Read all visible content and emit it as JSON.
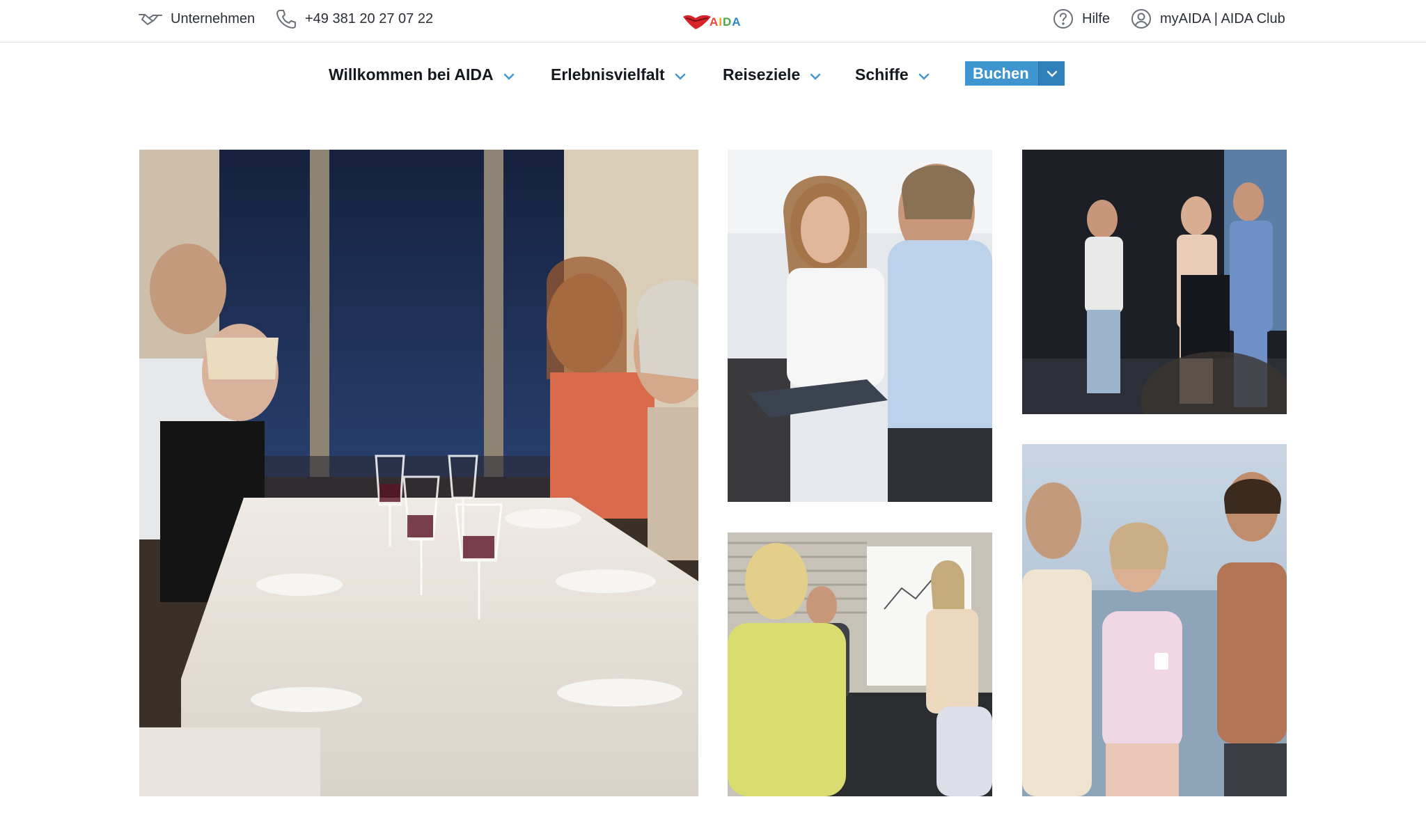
{
  "topbar": {
    "company_label": "Unternehmen",
    "phone_label": "+49 381 20 27 07 22",
    "help_label": "Hilfe",
    "account_label": "myAIDA | AIDA Club",
    "logo_text": [
      "A",
      "I",
      "D",
      "A"
    ]
  },
  "nav": {
    "items": [
      {
        "label": "Willkommen bei AIDA"
      },
      {
        "label": "Erlebnisvielfalt"
      },
      {
        "label": "Reiseziele"
      },
      {
        "label": "Schiffe"
      }
    ],
    "book_label": "Buchen"
  },
  "colors": {
    "accent": "#3f95cf",
    "accent_dark": "#2f7fba",
    "logo_red": "#d6242a",
    "logo_letters": [
      "#e64a3c",
      "#f2a31b",
      "#4aa84a",
      "#2f86c9"
    ]
  },
  "icons": {
    "company": "handshake-icon",
    "phone": "phone-icon",
    "help": "help-circle-icon",
    "account": "user-circle-icon",
    "nav_chevron": "chevron-down-icon"
  },
  "photos": [
    {
      "name": "photo-dinner-table"
    },
    {
      "name": "photo-tablet-consult"
    },
    {
      "name": "photo-stage-presentation"
    },
    {
      "name": "photo-conference-meeting"
    },
    {
      "name": "photo-deck-conversation"
    }
  ]
}
